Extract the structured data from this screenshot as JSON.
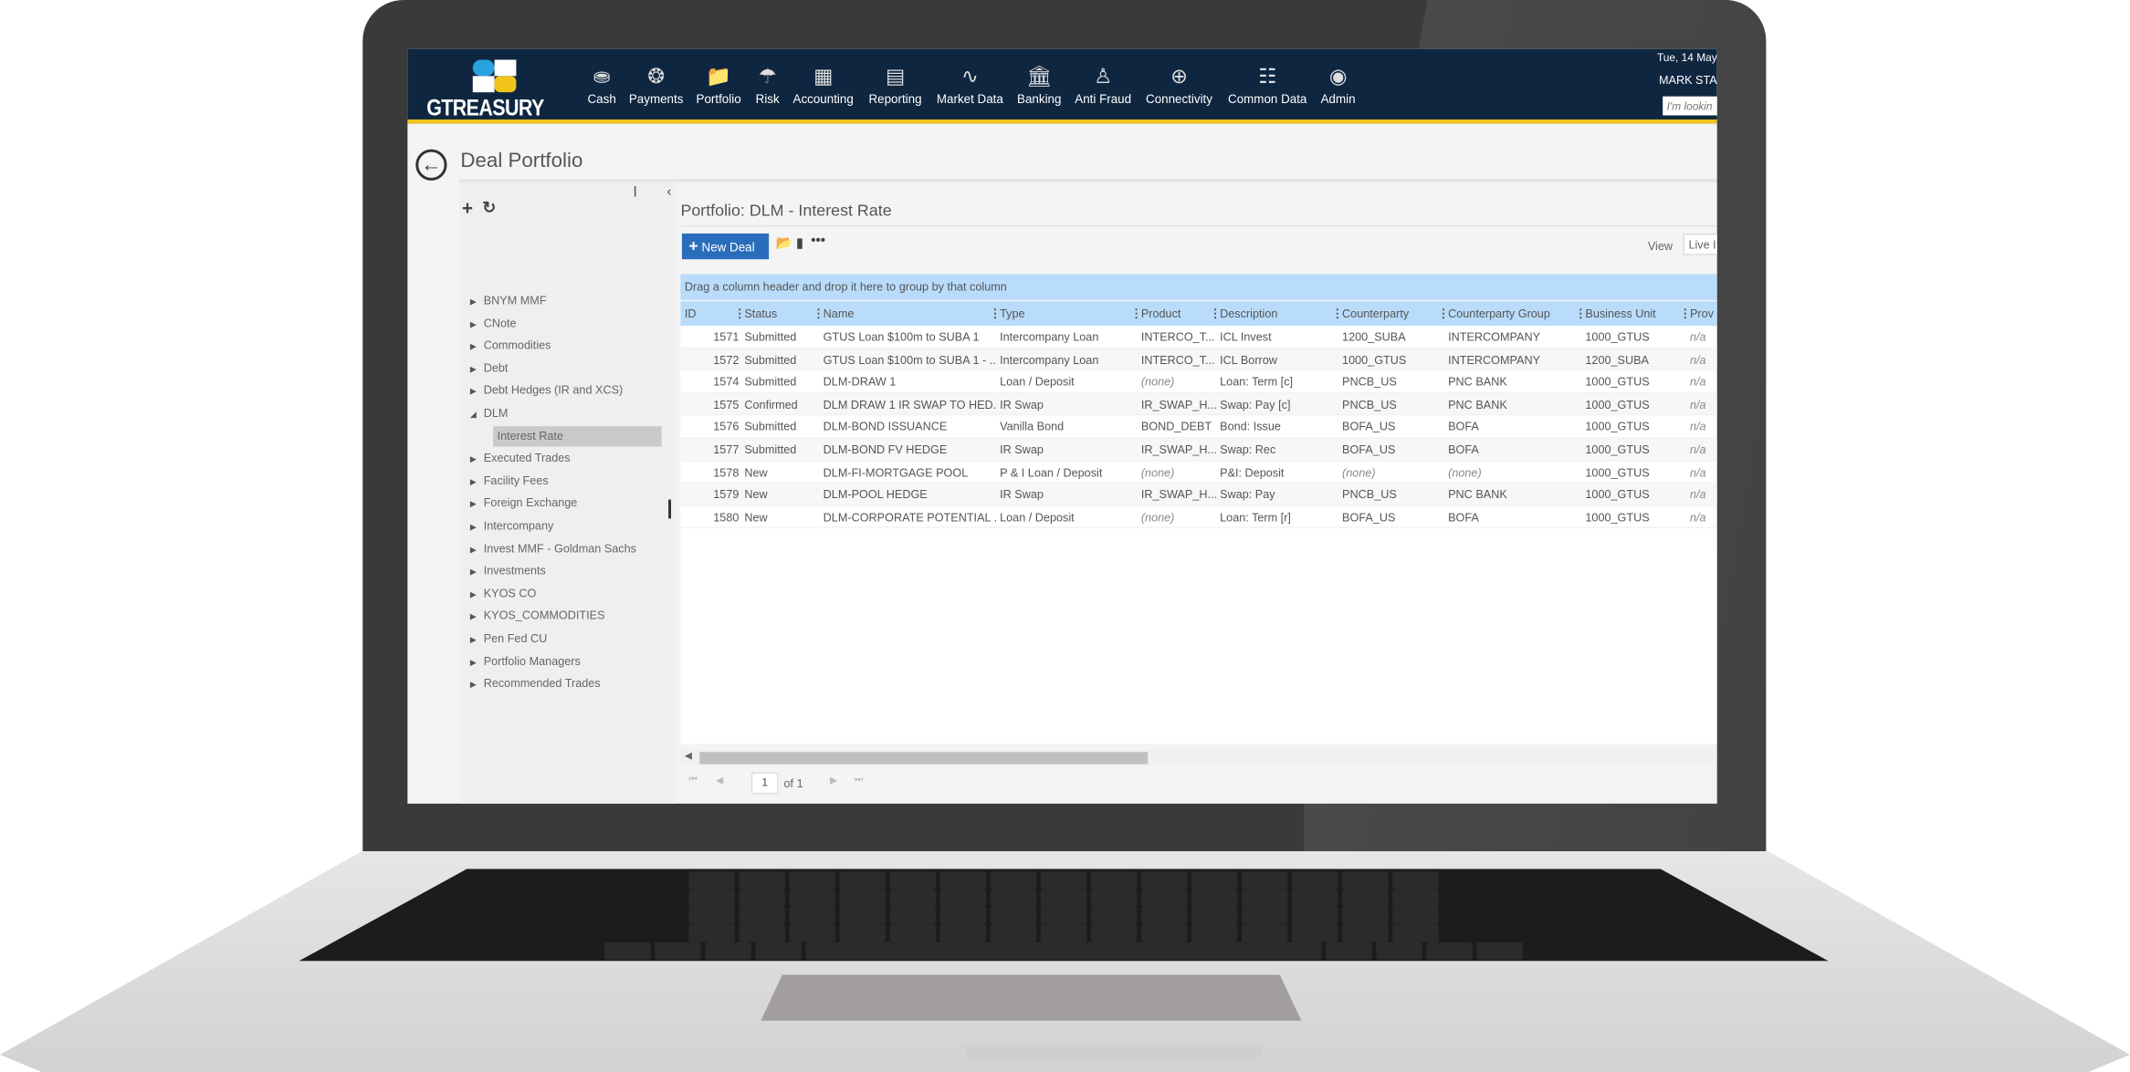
{
  "app": {
    "logo_text": "GTREASURY",
    "date": "Tue, 14 May",
    "user": "MARK STA",
    "search_placeholder": "I'm lookin",
    "nav": [
      {
        "label": "Cash",
        "icon": "coins-icon"
      },
      {
        "label": "Payments",
        "icon": "payments-icon"
      },
      {
        "label": "Portfolio",
        "icon": "folder-icon"
      },
      {
        "label": "Risk",
        "icon": "umbrella-icon"
      },
      {
        "label": "Accounting",
        "icon": "calculator-icon"
      },
      {
        "label": "Reporting",
        "icon": "chart-board-icon"
      },
      {
        "label": "Market Data",
        "icon": "pulse-icon"
      },
      {
        "label": "Banking",
        "icon": "bank-icon"
      },
      {
        "label": "Anti Fraud",
        "icon": "fraud-icon"
      },
      {
        "label": "Connectivity",
        "icon": "connectivity-icon"
      },
      {
        "label": "Common Data",
        "icon": "hierarchy-icon"
      },
      {
        "label": "Admin",
        "icon": "fingerprint-icon"
      }
    ],
    "colors": {
      "nav_bg": "#0f2640",
      "accent": "#f0c419",
      "button": "#2a6ebb",
      "header": "#b9dcfb"
    }
  },
  "page": {
    "title": "Deal Portfolio",
    "portfolio_title": "Portfolio: DLM - Interest Rate",
    "new_deal": "New Deal",
    "view_label": "View",
    "view_value": "Live I",
    "group_hint": "Drag a column header and drop it here to group by that column"
  },
  "tree": {
    "items": [
      "BNYM MMF",
      "CNote",
      "Commodities",
      "Debt",
      "Debt Hedges (IR and XCS)",
      "DLM",
      "Interest Rate",
      "Executed Trades",
      "Facility Fees",
      "Foreign Exchange",
      "Intercompany",
      "Invest MMF - Goldman Sachs",
      "Investments",
      "KYOS CO",
      "KYOS_COMMODITIES",
      "Pen Fed CU",
      "Portfolio Managers",
      "Recommended Trades"
    ],
    "selected": "Interest Rate",
    "expanded": "DLM"
  },
  "grid": {
    "columns": [
      "ID",
      "Status",
      "Name",
      "Type",
      "Product",
      "Description",
      "Counterparty",
      "Counterparty Group",
      "Business Unit",
      "Prov"
    ],
    "rows": [
      [
        "1571",
        "Submitted",
        "GTUS Loan $100m to SUBA 1",
        "Intercompany Loan",
        "INTERCO_T...",
        "ICL Invest",
        "1200_SUBA",
        "INTERCOMPANY",
        "1000_GTUS",
        "n/a"
      ],
      [
        "1572",
        "Submitted",
        "GTUS Loan $100m to SUBA 1 - ...",
        "Intercompany Loan",
        "INTERCO_T...",
        "ICL Borrow",
        "1000_GTUS",
        "INTERCOMPANY",
        "1200_SUBA",
        "n/a"
      ],
      [
        "1574",
        "Submitted",
        "DLM-DRAW 1",
        "Loan / Deposit",
        "(none)",
        "Loan: Term [c]",
        "PNCB_US",
        "PNC BANK",
        "1000_GTUS",
        "n/a"
      ],
      [
        "1575",
        "Confirmed",
        "DLM DRAW 1 IR SWAP TO HED...",
        "IR Swap",
        "IR_SWAP_H...",
        "Swap: Pay [c]",
        "PNCB_US",
        "PNC BANK",
        "1000_GTUS",
        "n/a"
      ],
      [
        "1576",
        "Submitted",
        "DLM-BOND ISSUANCE",
        "Vanilla Bond",
        "BOND_DEBT",
        "Bond: Issue",
        "BOFA_US",
        "BOFA",
        "1000_GTUS",
        "n/a"
      ],
      [
        "1577",
        "Submitted",
        "DLM-BOND FV HEDGE",
        "IR Swap",
        "IR_SWAP_H...",
        "Swap: Rec",
        "BOFA_US",
        "BOFA",
        "1000_GTUS",
        "n/a"
      ],
      [
        "1578",
        "New",
        "DLM-FI-MORTGAGE POOL",
        "P & I Loan / Deposit",
        "(none)",
        "P&I: Deposit",
        "(none)",
        "(none)",
        "1000_GTUS",
        "n/a"
      ],
      [
        "1579",
        "New",
        "DLM-POOL HEDGE",
        "IR Swap",
        "IR_SWAP_H...",
        "Swap: Pay",
        "PNCB_US",
        "PNC BANK",
        "1000_GTUS",
        "n/a"
      ],
      [
        "1580",
        "New",
        "DLM-CORPORATE POTENTIAL ...",
        "Loan / Deposit",
        "(none)",
        "Loan: Term [r]",
        "BOFA_US",
        "BOFA",
        "1000_GTUS",
        "n/a"
      ]
    ]
  },
  "pager": {
    "page": "1",
    "of": "of 1"
  }
}
